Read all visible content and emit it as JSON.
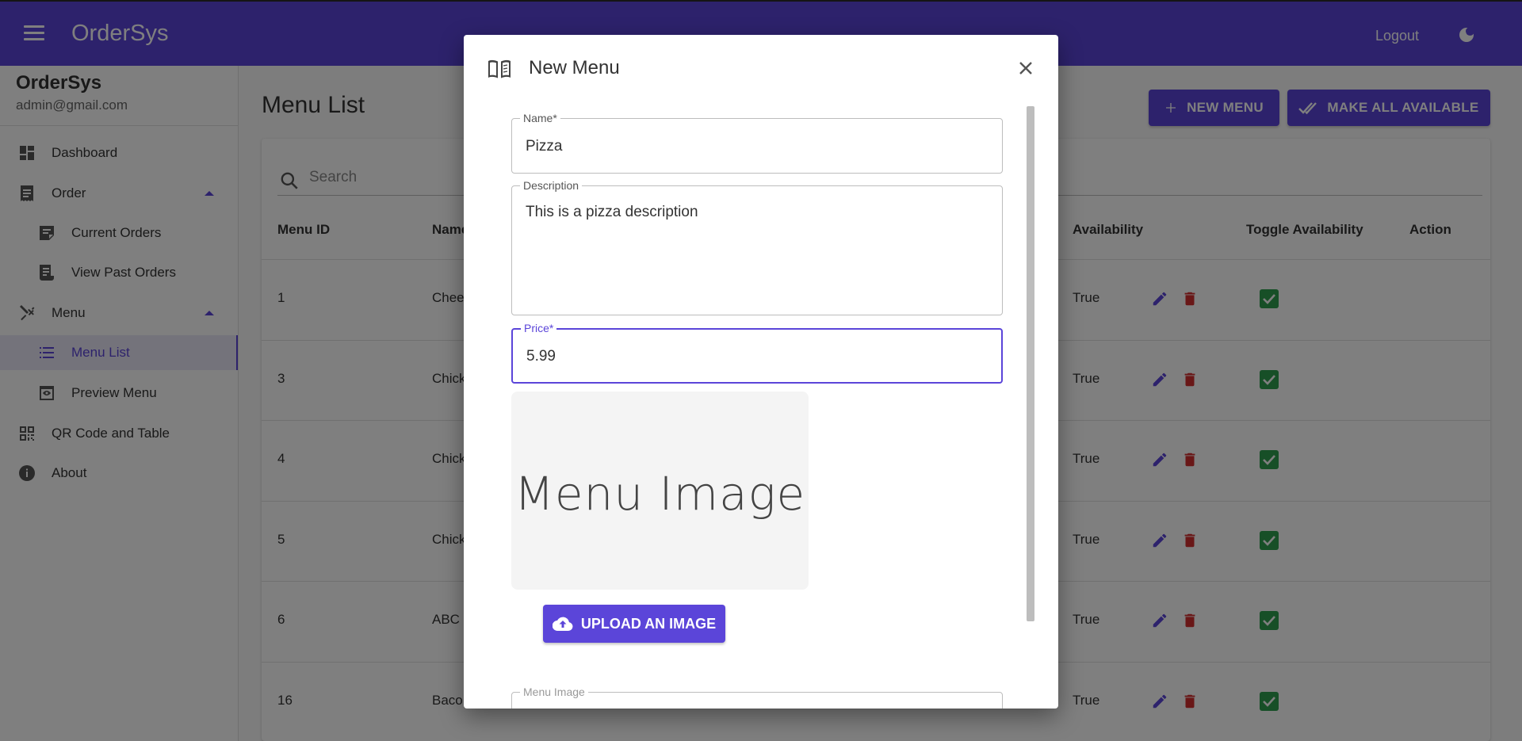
{
  "appbar": {
    "brand": "OrderSys",
    "logout": "Logout"
  },
  "sidebar": {
    "title": "OrderSys",
    "email": "admin@gmail.com",
    "items": [
      {
        "label": "Dashboard"
      },
      {
        "label": "Order"
      },
      {
        "label": "Current Orders"
      },
      {
        "label": "View Past Orders"
      },
      {
        "label": "Menu"
      },
      {
        "label": "Menu List"
      },
      {
        "label": "Preview Menu"
      },
      {
        "label": "QR Code and Table"
      },
      {
        "label": "About"
      }
    ]
  },
  "main": {
    "title": "Menu List",
    "new_menu_label": "NEW MENU",
    "make_all_label": "MAKE ALL AVAILABLE",
    "search_placeholder": "Search",
    "columns": [
      "Menu ID",
      "Name",
      "Availability",
      "Toggle Availability",
      "Action"
    ],
    "rows": [
      {
        "id": "1",
        "name": "Chee",
        "availability": "True"
      },
      {
        "id": "3",
        "name": "Chick",
        "availability": "True"
      },
      {
        "id": "4",
        "name": "Chick",
        "availability": "True"
      },
      {
        "id": "5",
        "name": "Chick",
        "availability": "True"
      },
      {
        "id": "6",
        "name": "ABC",
        "availability": "True"
      },
      {
        "id": "16",
        "name": "Baco",
        "availability": "True"
      }
    ]
  },
  "dialog": {
    "title": "New Menu",
    "name_label": "Name*",
    "name_value": "Pizza",
    "description_label": "Description",
    "description_value": "This is a pizza description",
    "price_label": "Price*",
    "price_value": "5.99",
    "image_placeholder_text": "Menu Image",
    "upload_label": "UPLOAD AN IMAGE",
    "menu_image_label": "Menu Image"
  },
  "colors": {
    "primary": "#5b45d9",
    "success": "#2e9e4f",
    "danger": "#d32f2f"
  }
}
